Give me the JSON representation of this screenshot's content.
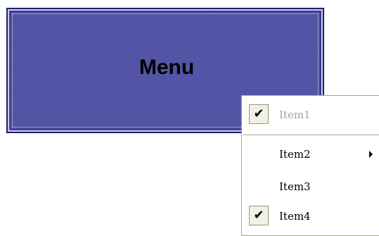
{
  "menu_button": {
    "label": "Menu"
  },
  "popup_menu": {
    "items": [
      {
        "label": "Item1",
        "checked": true,
        "enabled": false,
        "submenu": false
      },
      {
        "label": "Item2",
        "checked": false,
        "enabled": true,
        "submenu": true
      },
      {
        "label": "Item3",
        "checked": false,
        "enabled": true,
        "submenu": false
      },
      {
        "label": "Item4",
        "checked": true,
        "enabled": true,
        "submenu": false
      }
    ],
    "check_glyph": "✔"
  }
}
